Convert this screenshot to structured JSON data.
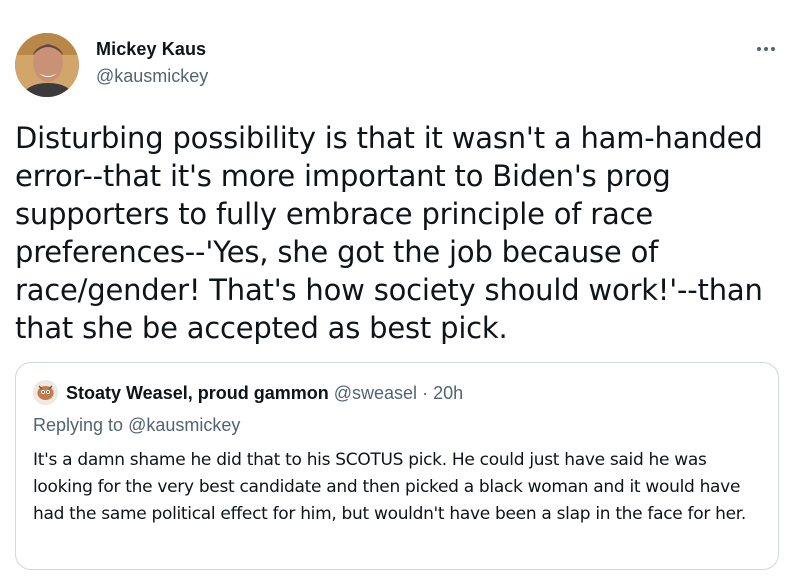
{
  "author": {
    "name": "Mickey Kaus",
    "handle": "@kausmickey"
  },
  "tweet": {
    "text": "Disturbing possibility is that it wasn't a ham-handed error--that it's more important to Biden's prog supporters to fully embrace principle of race preferences--'Yes, she got the job because of race/gender! That's how society should work!'--than that she be accepted as best pick."
  },
  "quoted_tweet": {
    "author_name": "Stoaty Weasel, proud gammon",
    "author_handle": "@sweasel",
    "separator": "·",
    "time": "20h",
    "replying_label": "Replying to",
    "replying_handle": "@kausmickey",
    "text": "It's a damn shame he did that to his SCOTUS pick. He could just have said he was looking for the very best candidate and then picked a black woman and it would have had the same political effect for him, but wouldn't have been a slap in the face for her."
  },
  "icons": {
    "more": "more-options-icon",
    "author_avatar": "profile-photo",
    "quote_avatar": "profile-photo"
  },
  "colors": {
    "primary_text": "#0f1419",
    "secondary_text": "#536471",
    "border": "#cfd9de",
    "background": "#ffffff"
  }
}
